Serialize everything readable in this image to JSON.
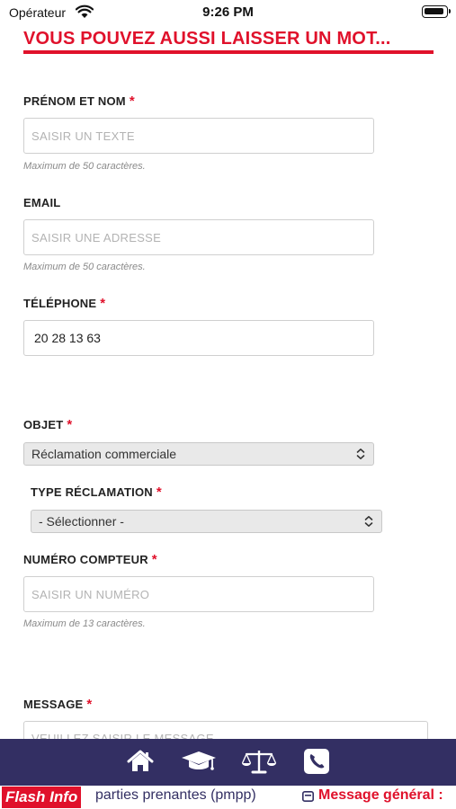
{
  "status_bar": {
    "carrier": "Opérateur",
    "time": "9:26 PM"
  },
  "form": {
    "heading": "VOUS POUVEZ AUSSI LAISSER UN MOT...",
    "required_mark": "*",
    "name": {
      "label": "PRÉNOM ET NOM",
      "placeholder": "SAISIR UN TEXTE",
      "hint": "Maximum de 50 caractères."
    },
    "email": {
      "label": "EMAIL",
      "placeholder": "SAISIR UNE ADRESSE",
      "hint": "Maximum de 50 caractères."
    },
    "phone": {
      "label": "TÉLÉPHONE",
      "value": "20 28 13 63"
    },
    "subject": {
      "label": "OBJET",
      "selected": "Réclamation commerciale"
    },
    "claim_type": {
      "label": "TYPE RÉCLAMATION",
      "selected": "- Sélectionner -"
    },
    "meter_number": {
      "label": "NUMÉRO COMPTEUR",
      "placeholder": "SAISIR UN NUMÉRO",
      "hint": "Maximum de 13 caractères."
    },
    "message": {
      "label": "MESSAGE",
      "placeholder": "VEUILLEZ SAISIR LE MESSAGE"
    }
  },
  "bottom_nav": {
    "items": [
      {
        "icon": "home-icon"
      },
      {
        "icon": "graduation-cap-icon"
      },
      {
        "icon": "balance-scale-icon"
      },
      {
        "icon": "phone-icon"
      }
    ]
  },
  "ticker": {
    "badge": "Flash Info",
    "text": "parties prenantes (pmpp)",
    "message": "Message général :"
  },
  "colors": {
    "accent_red": "#e0112b",
    "nav_bg": "#332f63"
  }
}
